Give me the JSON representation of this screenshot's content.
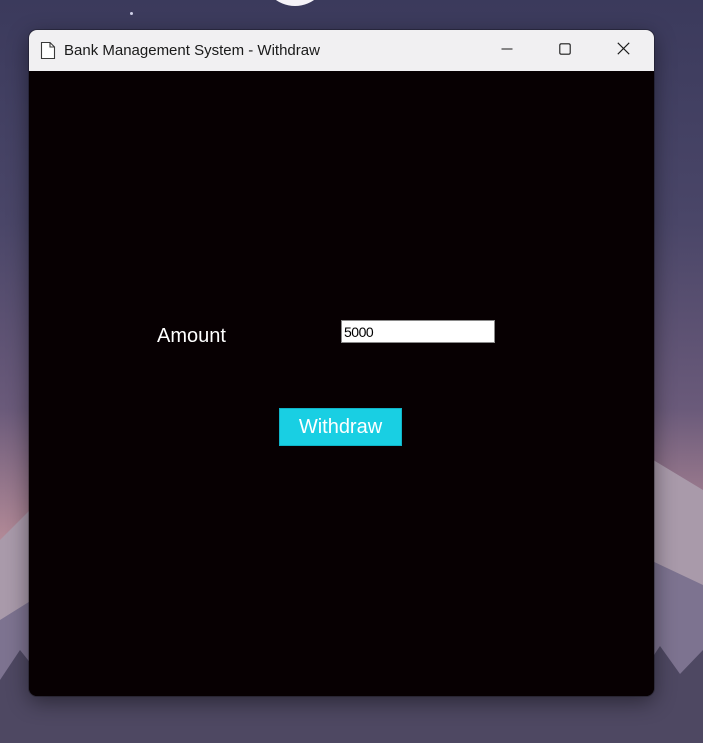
{
  "window": {
    "title": "Bank Management System - Withdraw",
    "icon": "document-icon"
  },
  "title_controls": {
    "minimize_icon": "minimize-icon",
    "maximize_icon": "maximize-icon",
    "close_icon": "close-icon"
  },
  "form": {
    "amount_label": "Amount",
    "amount_value": "5000",
    "withdraw_label": "Withdraw"
  },
  "colors": {
    "window_background": "#070002",
    "button_background": "#19cfe3",
    "text": "#ffffff",
    "titlebar": "#f1f0f2"
  }
}
